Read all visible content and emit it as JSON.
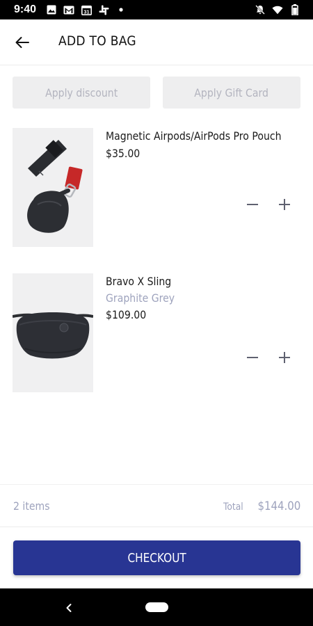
{
  "status_bar": {
    "time": "9:40",
    "left_icons": [
      "image-icon",
      "gmail-icon",
      "calendar-icon",
      "slack-icon",
      "dot-icon"
    ],
    "calendar_day": "31",
    "right_icons": [
      "bell-off-icon",
      "wifi-icon",
      "battery-icon"
    ]
  },
  "header": {
    "title": "ADD TO BAG",
    "back_icon": "arrow-left-icon"
  },
  "actions": {
    "discount_label": "Apply discount",
    "giftcard_label": "Apply Gift Card"
  },
  "items": [
    {
      "name": "Magnetic Airpods/AirPods Pro Pouch",
      "variant": "",
      "price": "$35.00",
      "image": "airpods-pouch-image"
    },
    {
      "name": "Bravo X Sling",
      "variant": "Graphite Grey",
      "price": "$109.00",
      "image": "sling-bag-image"
    }
  ],
  "summary": {
    "items_count": "2 items",
    "total_label": "Total",
    "total_value": "$144.00"
  },
  "checkout": {
    "label": "CHECKOUT"
  },
  "colors": {
    "accent": "#283593",
    "muted": "#9ea3bd",
    "button_bg": "#eeeeef",
    "strap_red": "#c62828"
  }
}
